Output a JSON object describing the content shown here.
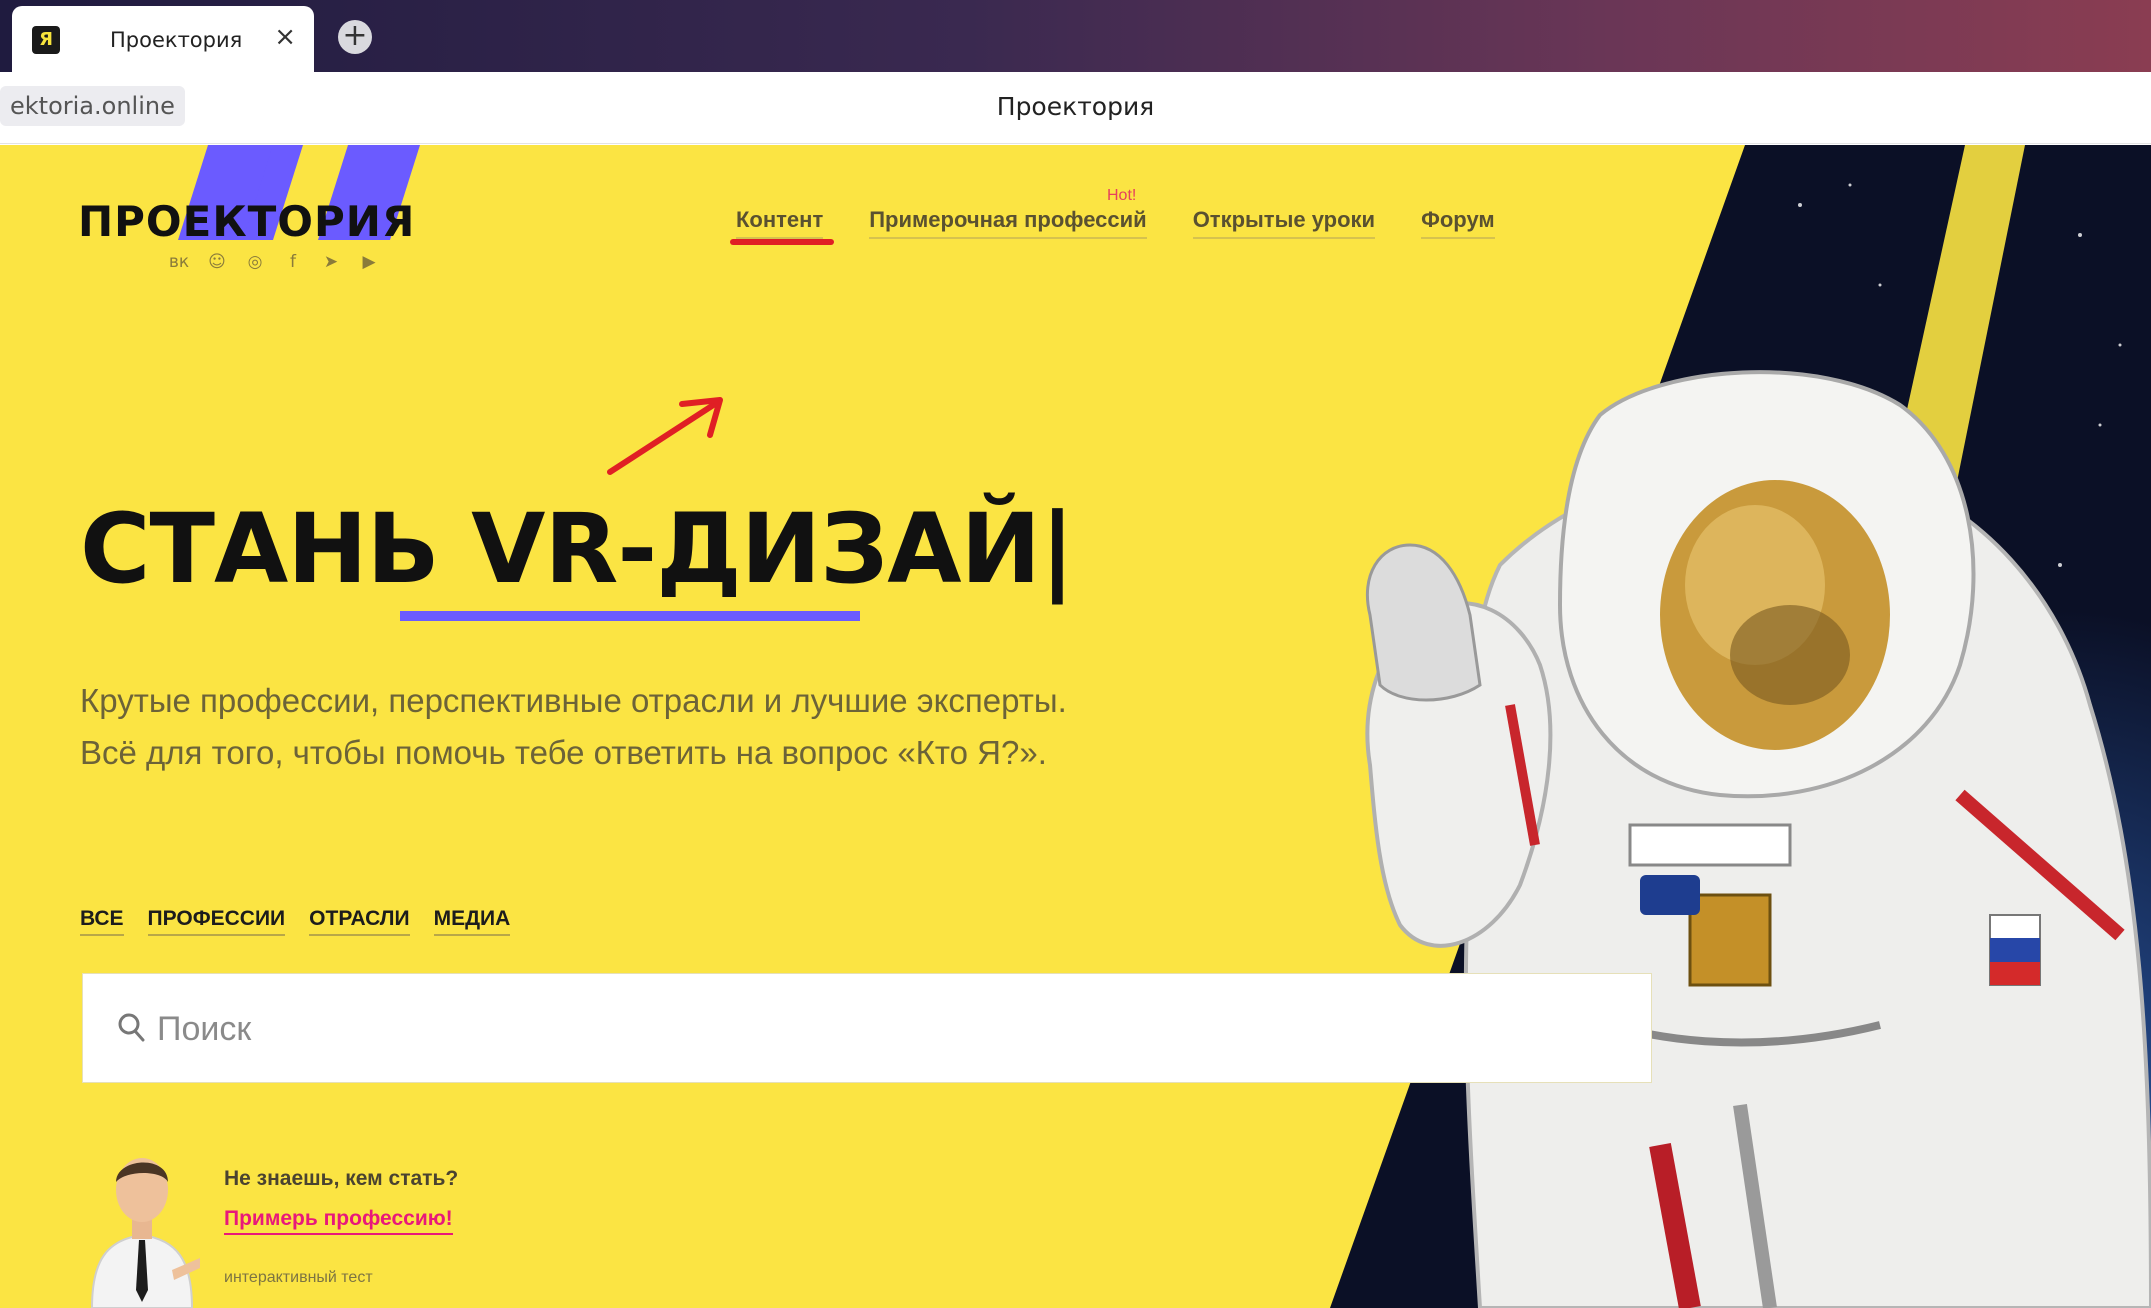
{
  "browser": {
    "tab_title": "Проектория",
    "tab_close": "×",
    "new_tab": "+",
    "url": "ektoria.online",
    "page_title": "Проектория"
  },
  "site": {
    "logo_text": "ПРОЕКТОРИЯ",
    "socials": [
      "vk-icon",
      "odnoklassniki-icon",
      "instagram-icon",
      "facebook-icon",
      "telegram-icon",
      "youtube-icon"
    ],
    "nav": [
      {
        "label": "Контент"
      },
      {
        "label": "Примерочная профессий"
      },
      {
        "label": "Открытые уроки"
      },
      {
        "label": "Форум"
      }
    ],
    "nav_badge": "Hot!"
  },
  "hero": {
    "title": "СТАНЬ VR-ДИЗАЙ|",
    "subtitle_line1": "Крутые профессии, перспективные отрасли и лучшие эксперты.",
    "subtitle_line2": "Всё для того, чтобы помочь тебе ответить на вопрос «Кто Я?»."
  },
  "filters": [
    "ВСЕ",
    "ПРОФЕССИИ",
    "ОТРАСЛИ",
    "МЕДИА"
  ],
  "search": {
    "placeholder": "Поиск"
  },
  "promo": {
    "question": "Не знаешь, кем стать?",
    "link": "Примерь профессию!",
    "note": "интерактивный тест"
  },
  "colors": {
    "page_bg": "#fbe443",
    "accent_violet": "#6b5bff",
    "annotation_red": "#e01f24",
    "link_pink": "#e8197a"
  }
}
